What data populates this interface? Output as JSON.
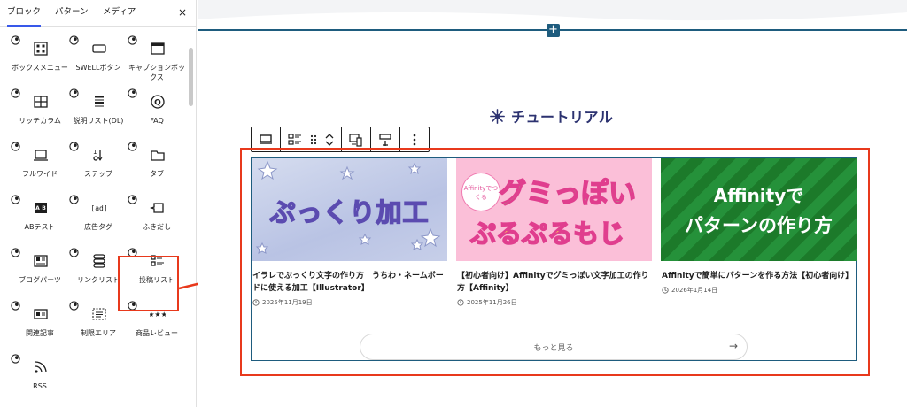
{
  "sidebar": {
    "tabs": [
      {
        "label": "ブロック",
        "active": true
      },
      {
        "label": "パターン",
        "active": false
      },
      {
        "label": "メディア",
        "active": false
      }
    ],
    "close_icon": "×",
    "blocks": [
      {
        "label": "ボックスメニュー",
        "icon": "grid-box-icon"
      },
      {
        "label": "SWELLボタン",
        "icon": "button-icon"
      },
      {
        "label": "キャプションボックス",
        "icon": "caption-box-icon"
      },
      {
        "label": "リッチカラム",
        "icon": "columns-icon"
      },
      {
        "label": "説明リスト(DL)",
        "icon": "description-list-icon"
      },
      {
        "label": "FAQ",
        "icon": "faq-icon"
      },
      {
        "label": "フルワイド",
        "icon": "full-wide-icon"
      },
      {
        "label": "ステップ",
        "icon": "step-icon"
      },
      {
        "label": "タブ",
        "icon": "tab-icon"
      },
      {
        "label": "ABテスト",
        "icon": "ab-test-icon"
      },
      {
        "label": "広告タグ",
        "icon": "ad-tag-icon"
      },
      {
        "label": "ふきだし",
        "icon": "balloon-icon"
      },
      {
        "label": "ブログパーツ",
        "icon": "blog-parts-icon"
      },
      {
        "label": "リンクリスト",
        "icon": "link-list-icon"
      },
      {
        "label": "投稿リスト",
        "icon": "post-list-icon"
      },
      {
        "label": "関連記事",
        "icon": "related-post-icon"
      },
      {
        "label": "制限エリア",
        "icon": "restricted-area-icon"
      },
      {
        "label": "商品レビュー",
        "icon": "product-review-icon"
      },
      {
        "label": "RSS",
        "icon": "rss-icon"
      }
    ],
    "highlighted_block": "投稿リスト"
  },
  "editor": {
    "inserter_label": "+",
    "heading": "チュートリアル",
    "posts": [
      {
        "thumb_text": "ぷっくり加工",
        "title": "イラレでぷっくり文字の作り方｜うちわ・ネームボードに使える加工【Illustrator】",
        "date": "2025年11月19日"
      },
      {
        "thumb_badge": "Affinityでつくる",
        "thumb_text_1": "グミっぽい",
        "thumb_text_2": "ぷるぷるもじ",
        "title": "【初心者向け】Affinityでグミっぽい文字加工の作り方【Affinity】",
        "date": "2025年11月26日"
      },
      {
        "thumb_text_1": "Affinityで",
        "thumb_text_2": "パターンの作り方",
        "title": "Affinityで簡単にパターンを作る方法【初心者向け】",
        "date": "2026年1月14日"
      }
    ],
    "more_button": {
      "label": "もっと見る",
      "arrow": "→"
    }
  },
  "colors": {
    "accent_blue": "#1e5c7e",
    "highlight_red": "#e8391c",
    "heading_navy": "#2c3270",
    "tab_active": "#3858e9"
  }
}
